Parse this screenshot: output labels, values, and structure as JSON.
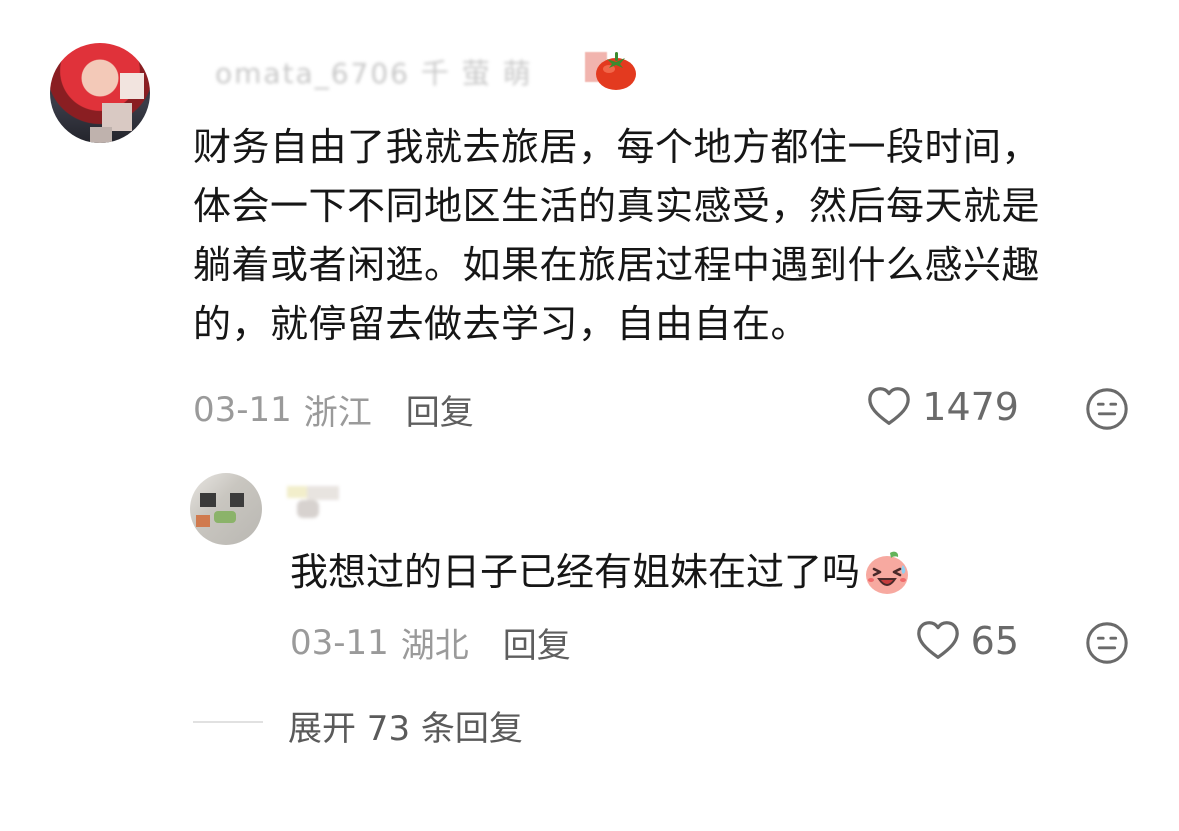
{
  "comment": {
    "username": "omata_6706 千 萤 萌",
    "text_lines": [
      "财务自由了我就去旅居，每个地方都住一段时间，",
      "体会一下不同地区生活的真实感受，然后每天就是",
      "躺着或者闲逛。如果在旅居过程中遇到什么感兴趣",
      "的，就停留去做去学习，自由自在。"
    ],
    "date": "03-11",
    "location": "浙江",
    "reply_label": "回复",
    "like_count": "1479",
    "icons": {
      "avatar": "avatar",
      "badge": "tomato-icon",
      "like": "heart-icon",
      "dislike": "frown-face-icon"
    }
  },
  "reply": {
    "text": "我想过的日子已经有姐妹在过了吗",
    "emoji": "laughing-pig-face-icon",
    "date": "03-11",
    "location": "湖北",
    "reply_label": "回复",
    "like_count": "65"
  },
  "expand": {
    "label": "展开 73 条回复"
  },
  "colors": {
    "text_primary": "#161616",
    "text_meta": "#9a9a9a",
    "text_action": "#5e5e5e",
    "divider": "#e1e1e1"
  }
}
